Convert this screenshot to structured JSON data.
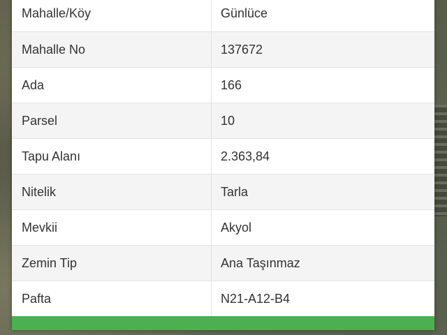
{
  "parcel_info": {
    "rows": [
      {
        "label": "Mahalle/Köy",
        "value": "Günlüce"
      },
      {
        "label": "Mahalle No",
        "value": "137672"
      },
      {
        "label": "Ada",
        "value": "166"
      },
      {
        "label": "Parsel",
        "value": "10"
      },
      {
        "label": "Tapu Alanı",
        "value": "2.363,84"
      },
      {
        "label": "Nitelik",
        "value": "Tarla"
      },
      {
        "label": "Mevkii",
        "value": "Akyol"
      },
      {
        "label": "Zemin Tip",
        "value": "Ana Taşınmaz"
      },
      {
        "label": "Pafta",
        "value": "N21-A12-B4"
      }
    ]
  },
  "colors": {
    "accent_green": "#4caf50",
    "row_alt": "#f4f4f4",
    "text": "#333333"
  }
}
